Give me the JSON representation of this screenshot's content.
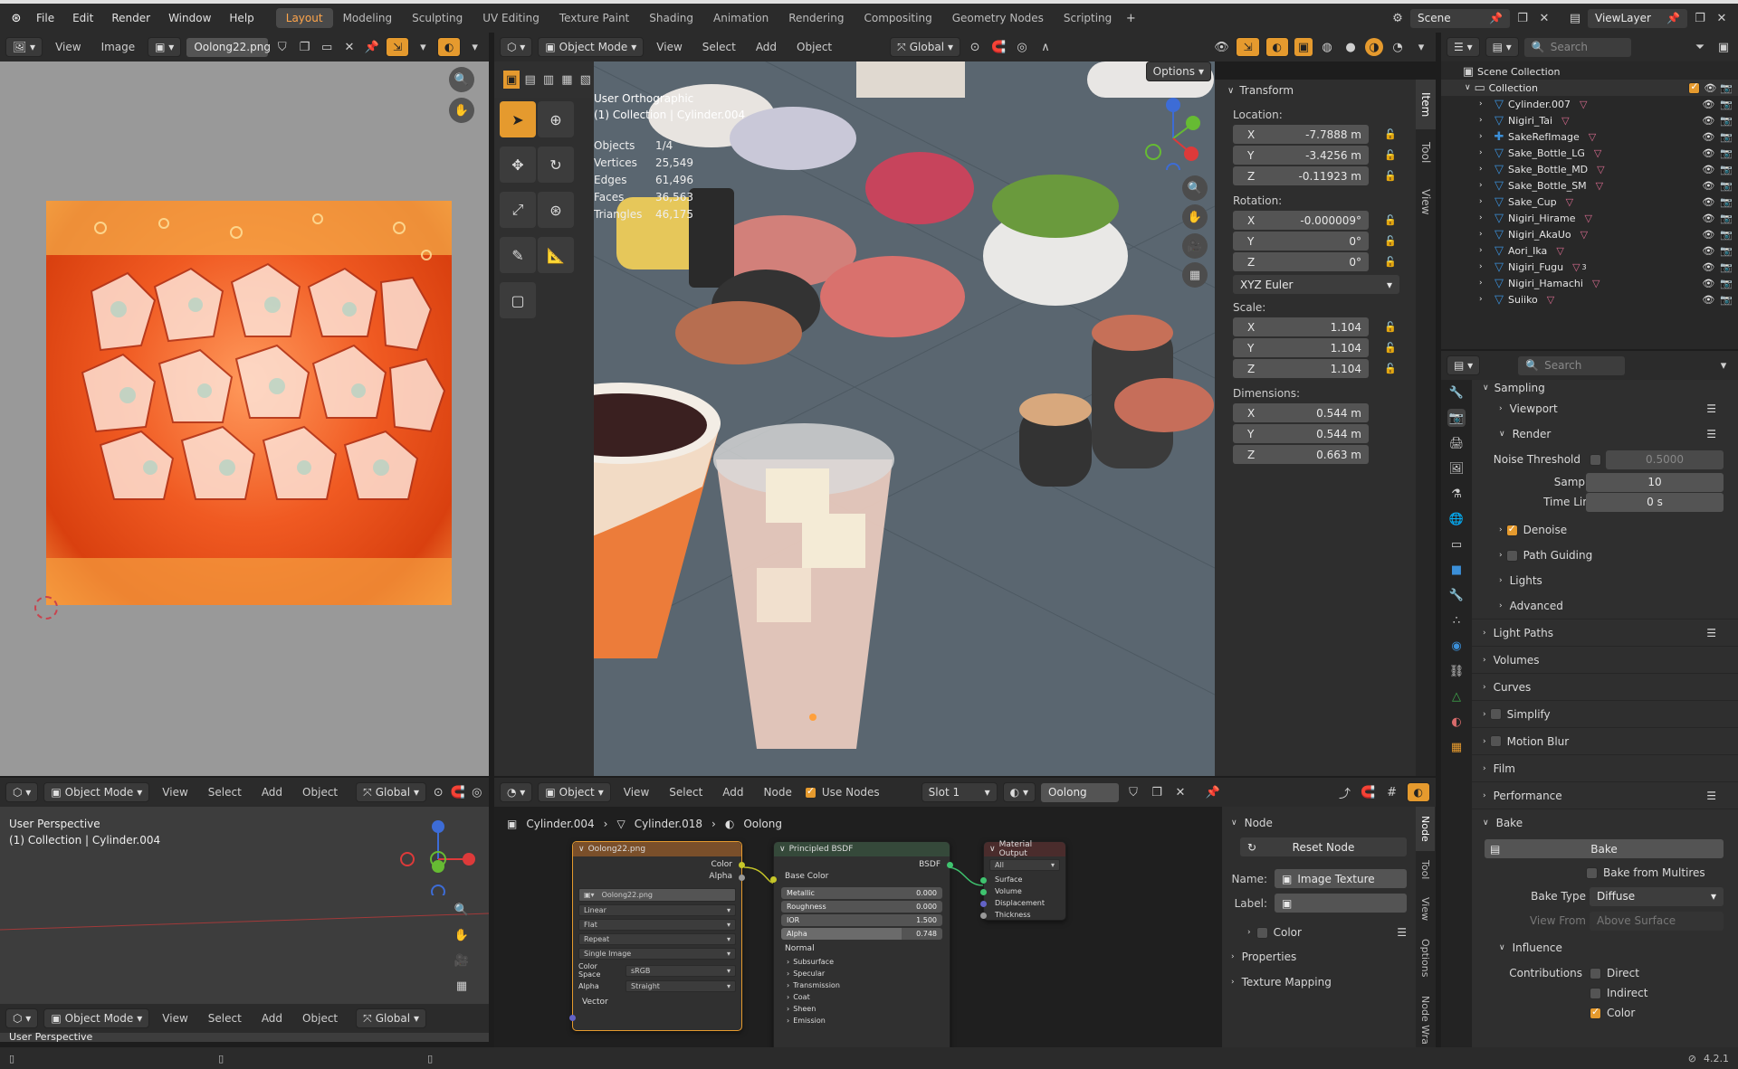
{
  "topbar": {
    "menus": [
      "File",
      "Edit",
      "Render",
      "Window",
      "Help"
    ],
    "workspaces": [
      "Layout",
      "Modeling",
      "Sculpting",
      "UV Editing",
      "Texture Paint",
      "Shading",
      "Animation",
      "Rendering",
      "Compositing",
      "Geometry Nodes",
      "Scripting"
    ],
    "active_workspace": "Layout",
    "scene": "Scene",
    "view_layer": "ViewLayer"
  },
  "image_editor": {
    "menus": [
      "View",
      "Image"
    ],
    "image_name": "Oolong22.png"
  },
  "viewport_main": {
    "mode": "Object Mode",
    "menus": [
      "View",
      "Select",
      "Add",
      "Object"
    ],
    "transform_orientation": "Global",
    "options_label": "Options",
    "view_name": "User Orthographic",
    "collection_path": "(1) Collection | Cylinder.004",
    "stats": [
      {
        "label": "Objects",
        "value": "1/4"
      },
      {
        "label": "Vertices",
        "value": "25,549"
      },
      {
        "label": "Edges",
        "value": "61,496"
      },
      {
        "label": "Faces",
        "value": "36,563"
      },
      {
        "label": "Triangles",
        "value": "46,175"
      }
    ]
  },
  "transform_panel": {
    "title": "Transform",
    "location_label": "Location:",
    "location": [
      {
        "axis": "X",
        "value": "-7.7888 m"
      },
      {
        "axis": "Y",
        "value": "-3.4256 m"
      },
      {
        "axis": "Z",
        "value": "-0.11923 m"
      }
    ],
    "rotation_label": "Rotation:",
    "rotation": [
      {
        "axis": "X",
        "value": "-0.000009°"
      },
      {
        "axis": "Y",
        "value": "0°"
      },
      {
        "axis": "Z",
        "value": "0°"
      }
    ],
    "rotation_mode": "XYZ Euler",
    "scale_label": "Scale:",
    "scale": [
      {
        "axis": "X",
        "value": "1.104"
      },
      {
        "axis": "Y",
        "value": "1.104"
      },
      {
        "axis": "Z",
        "value": "1.104"
      }
    ],
    "dimensions_label": "Dimensions:",
    "dimensions": [
      {
        "axis": "X",
        "value": "0.544 m"
      },
      {
        "axis": "Y",
        "value": "0.544 m"
      },
      {
        "axis": "Z",
        "value": "0.663 m"
      }
    ],
    "tabs": [
      "Item",
      "Tool",
      "View"
    ]
  },
  "outliner": {
    "search_placeholder": "Search",
    "scene_collection": "Scene Collection",
    "collection": "Collection",
    "items": [
      "Cylinder.007",
      "Nigiri_Tai",
      "SakeRefImage",
      "Sake_Bottle_LG",
      "Sake_Bottle_MD",
      "Sake_Bottle_SM",
      "Sake_Cup",
      "Nigiri_Hirame",
      "Nigiri_AkaUo",
      "Aori_Ika",
      "Nigiri_Fugu",
      "Nigiri_Hamachi",
      "Suiiko"
    ],
    "fugu_badge": "3"
  },
  "properties": {
    "search_placeholder": "Search",
    "sampling": "Sampling",
    "viewport": "Viewport",
    "render": "Render",
    "noise_threshold_label": "Noise Threshold",
    "noise_threshold": "0.5000",
    "samples_label": "Samples",
    "samples": "10",
    "time_limit_label": "Time Limit",
    "time_limit": "0 s",
    "denoise": "Denoise",
    "path_guiding": "Path Guiding",
    "lights": "Lights",
    "advanced": "Advanced",
    "light_paths": "Light Paths",
    "volumes": "Volumes",
    "curves": "Curves",
    "simplify": "Simplify",
    "motion_blur": "Motion Blur",
    "film": "Film",
    "performance": "Performance",
    "bake": "Bake",
    "bake_button": "Bake",
    "bake_from_multires": "Bake from Multires",
    "bake_type_label": "Bake Type",
    "bake_type": "Diffuse",
    "view_from_label": "View From",
    "view_from": "Above Surface",
    "influence": "Influence",
    "contributions_label": "Contributions",
    "direct": "Direct",
    "indirect": "Indirect",
    "color": "Color"
  },
  "viewport_small": {
    "mode": "Object Mode",
    "menus": [
      "View",
      "Select",
      "Add",
      "Object"
    ],
    "transform_orientation": "Global",
    "view_name": "User Perspective",
    "collection_path": "(1) Collection | Cylinder.004"
  },
  "viewport_small2": {
    "mode": "Object Mode",
    "menus": [
      "View",
      "Select",
      "Add",
      "Object"
    ],
    "transform_orientation": "Global",
    "view_name": "User Perspective"
  },
  "node_editor": {
    "type": "Object",
    "menus": [
      "View",
      "Select",
      "Add",
      "Node"
    ],
    "use_nodes": "Use Nodes",
    "slot": "Slot 1",
    "material": "Oolong",
    "breadcrumb": [
      "Cylinder.004",
      "Cylinder.018",
      "Oolong"
    ],
    "image_node": {
      "title": "Oolong22.png",
      "out_color": "Color",
      "out_alpha": "Alpha",
      "image": "Oolong22.png",
      "interpolation": "Linear",
      "projection": "Flat",
      "extension": "Repeat",
      "source": "Single Image",
      "color_space_label": "Color Space",
      "color_space": "sRGB",
      "alpha_label": "Alpha",
      "alpha": "Straight",
      "vector": "Vector"
    },
    "bsdf_node": {
      "title": "Principled BSDF",
      "out": "BSDF",
      "base_color": "Base Color",
      "metallic": {
        "label": "Metallic",
        "value": "0.000"
      },
      "roughness": {
        "label": "Roughness",
        "value": "0.000"
      },
      "ior": {
        "label": "IOR",
        "value": "1.500"
      },
      "alpha": {
        "label": "Alpha",
        "value": "0.748"
      },
      "normal": "Normal",
      "panels": [
        "Subsurface",
        "Specular",
        "Transmission",
        "Coat",
        "Sheen",
        "Emission"
      ]
    },
    "output_node": {
      "title": "Material Output",
      "target": "All",
      "inputs": [
        "Surface",
        "Volume",
        "Displacement",
        "Thickness"
      ]
    }
  },
  "node_sidebar": {
    "panel": "Node",
    "reset": "Reset Node",
    "name_label": "Name:",
    "name": "Image Texture",
    "label_label": "Label:",
    "color": "Color",
    "properties": "Properties",
    "texture_mapping": "Texture Mapping",
    "tabs": [
      "Node",
      "Tool",
      "View",
      "Options",
      "Node Wra"
    ]
  },
  "statusbar": {
    "version": "4.2.1"
  }
}
